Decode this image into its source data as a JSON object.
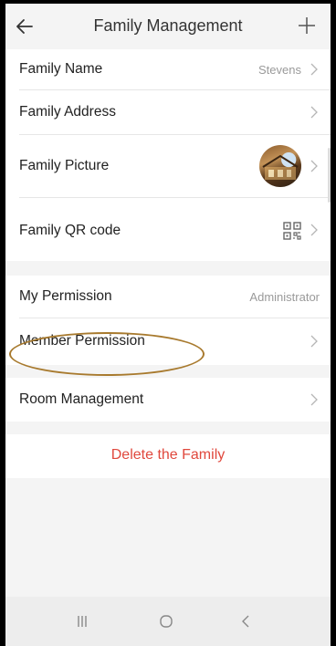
{
  "header": {
    "title": "Family Management",
    "back_icon": "back-arrow-icon",
    "add_icon": "plus-icon"
  },
  "family": {
    "name_label": "Family Name",
    "name_value": "Stevens",
    "address_label": "Family Address",
    "picture_label": "Family Picture",
    "qr_label": "Family QR code",
    "qr_icon": "qr-code-icon"
  },
  "permissions": {
    "my_permission_label": "My Permission",
    "my_permission_value": "Administrator",
    "member_permission_label": "Member Permission"
  },
  "rooms": {
    "room_management_label": "Room Management"
  },
  "actions": {
    "delete_label": "Delete the Family",
    "delete_color": "#e0483d"
  },
  "navbar": {
    "recent_icon": "recent-apps-icon",
    "home_icon": "home-icon",
    "back_icon": "nav-back-icon"
  },
  "colors": {
    "background": "#f4f4f4",
    "card": "#ffffff",
    "annotation": "#a87a2e"
  }
}
